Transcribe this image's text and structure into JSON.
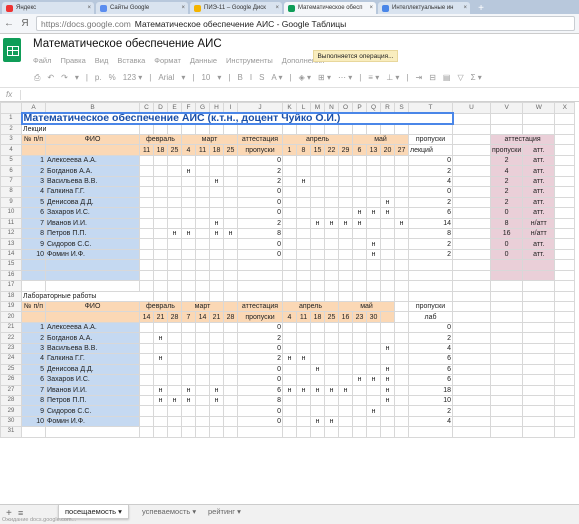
{
  "browser": {
    "tabs": [
      {
        "label": "Яндекс",
        "color": "#e33"
      },
      {
        "label": "Сайты Google",
        "color": "#5b8def"
      },
      {
        "label": "ПИЭ-11 – Google Диск",
        "color": "#f4b400"
      },
      {
        "label": "Математическое обесп",
        "color": "#0f9d58"
      },
      {
        "label": "Интеллектуальные ин",
        "color": "#4a86e8"
      }
    ],
    "active_tab_index": 3,
    "new_tab": "+",
    "back": "←",
    "forward": "Я",
    "url_prefix": "https://docs.google.com",
    "url_rest": "Математическое обеспечение АИС - Google Таблицы"
  },
  "doc": {
    "title": "Математическое обеспечение АИС",
    "menu": [
      "Файл",
      "Правка",
      "Вид",
      "Вставка",
      "Формат",
      "Данные",
      "Инструменты",
      "Дополнения"
    ],
    "operation": "Выполняется операция...",
    "toolbar": [
      "⎙",
      "↶",
      "↷",
      "▾",
      "|",
      "р.",
      "%",
      "123 ▾",
      "|",
      "Arial",
      "▾",
      "|",
      "10",
      "▾",
      "|",
      "B",
      "I",
      "S",
      "A ▾",
      "|",
      "◈ ▾",
      "⊞ ▾",
      "⋯ ▾",
      "|",
      "≡ ▾",
      "⊥ ▾",
      "|",
      "⇥",
      "⊟",
      "▤",
      "▽",
      "Σ ▾"
    ],
    "fx": "fx"
  },
  "columns": [
    "A",
    "B",
    "C",
    "D",
    "E",
    "F",
    "G",
    "H",
    "I",
    "J",
    "K",
    "L",
    "M",
    "N",
    "O",
    "P",
    "Q",
    "R",
    "S",
    "T",
    "U",
    "V",
    "W",
    "X"
  ],
  "rows": [
    {
      "n": "1",
      "c": [
        [
          "A1",
          "Математическое обеспечение АИС (к.т.н., доцент Чуйко О.И.)",
          "big",
          20
        ]
      ]
    },
    {
      "n": "2",
      "c": [
        [
          "A",
          "Лекции",
          "lbl",
          2
        ]
      ]
    },
    {
      "n": "3",
      "c": [
        [
          "A",
          "№ п/п",
          "or",
          1
        ],
        [
          "B",
          "ФИО",
          "or",
          1
        ],
        [
          "C",
          "февраль",
          "or",
          3
        ],
        [
          "F",
          "март",
          "or",
          4
        ],
        [
          "J",
          "аттестация",
          "or",
          1
        ],
        [
          "K",
          "апрель",
          "or",
          5
        ],
        [
          "P",
          "май",
          "or",
          4
        ],
        [
          "T",
          "пропуски",
          "c",
          1
        ],
        [
          "U",
          "",
          "",
          1
        ],
        [
          "V",
          "аттестация",
          "pk",
          2
        ]
      ]
    },
    {
      "n": "4",
      "c": [
        [
          "A",
          "",
          "or",
          1
        ],
        [
          "B",
          "",
          "or",
          1
        ],
        [
          "C",
          "11",
          "or",
          1
        ],
        [
          "D",
          "18",
          "or",
          1
        ],
        [
          "E",
          "25",
          "or",
          1
        ],
        [
          "F",
          "4",
          "or",
          1
        ],
        [
          "G",
          "11",
          "or",
          1
        ],
        [
          "H",
          "18",
          "or",
          1
        ],
        [
          "I",
          "25",
          "or",
          1
        ],
        [
          "J",
          "пропуски",
          "or",
          1
        ],
        [
          "K",
          "1",
          "or",
          1
        ],
        [
          "L",
          "8",
          "or",
          1
        ],
        [
          "M",
          "15",
          "or",
          1
        ],
        [
          "N",
          "22",
          "or",
          1
        ],
        [
          "O",
          "29",
          "or",
          1
        ],
        [
          "P",
          "6",
          "or",
          1
        ],
        [
          "Q",
          "13",
          "or",
          1
        ],
        [
          "R",
          "20",
          "or",
          1
        ],
        [
          "S",
          "27",
          "or",
          1
        ],
        [
          "T",
          "лекций",
          "",
          1
        ],
        [
          "U",
          "",
          "",
          1
        ],
        [
          "V",
          "пропуски",
          "pk",
          1
        ],
        [
          "W",
          "атт.",
          "pk",
          1
        ]
      ]
    }
  ],
  "lectures": [
    {
      "n": "5",
      "num": "1",
      "name": "Алексеева А.А.",
      "marks": {},
      "prop": "0",
      "total": "0",
      "vp": "2",
      "va": "атт."
    },
    {
      "n": "6",
      "num": "2",
      "name": "Богданов А.А.",
      "marks": {
        "F": "н"
      },
      "prop": "2",
      "total": "2",
      "vp": "4",
      "va": "атт."
    },
    {
      "n": "7",
      "num": "3",
      "name": "Васильева В.В.",
      "marks": {
        "H": "н",
        "L": "н"
      },
      "prop": "2",
      "total": "4",
      "vp": "2",
      "va": "атт."
    },
    {
      "n": "8",
      "num": "4",
      "name": "Галкина Г.Г.",
      "marks": {},
      "prop": "0",
      "total": "0",
      "vp": "2",
      "va": "атт."
    },
    {
      "n": "9",
      "num": "5",
      "name": "Денисова Д.Д.",
      "marks": {
        "R": "н"
      },
      "prop": "0",
      "total": "2",
      "vp": "2",
      "va": "атт."
    },
    {
      "n": "10",
      "num": "6",
      "name": "Захаров И.С.",
      "marks": {
        "P": "н",
        "Q": "н",
        "R": "н"
      },
      "prop": "0",
      "total": "6",
      "vp": "0",
      "va": "атт."
    },
    {
      "n": "11",
      "num": "7",
      "name": "Иванов И.И.",
      "marks": {
        "H": "н",
        "M": "н",
        "N": "н",
        "O": "н",
        "P": "н",
        "S": "н"
      },
      "prop": "2",
      "total": "14",
      "vp": "8",
      "va": "н/атт"
    },
    {
      "n": "12",
      "num": "8",
      "name": "Петров П.П.",
      "marks": {
        "E": "н",
        "F": "н",
        "H": "н",
        "I": "н"
      },
      "prop": "8",
      "total": "8",
      "vp": "16",
      "va": "н/атт"
    },
    {
      "n": "13",
      "num": "9",
      "name": "Сидоров С.С.",
      "marks": {
        "Q": "н"
      },
      "prop": "0",
      "total": "2",
      "vp": "0",
      "va": "атт."
    },
    {
      "n": "14",
      "num": "10",
      "name": "Фомин И.Ф.",
      "marks": {
        "Q": "н"
      },
      "prop": "0",
      "total": "2",
      "vp": "0",
      "va": "атт."
    }
  ],
  "blank_rows": [
    "15",
    "16",
    "17"
  ],
  "labs_label": {
    "n": "18",
    "text": "Лабораторные работы"
  },
  "labs_hdr": [
    {
      "n": "19",
      "c": [
        [
          "A",
          "№ п/п",
          "or",
          1
        ],
        [
          "B",
          "ФИО",
          "or",
          1
        ],
        [
          "C",
          "февраль",
          "or",
          3
        ],
        [
          "F",
          "март",
          "or",
          3
        ],
        [
          "I",
          "",
          "or",
          1
        ],
        [
          "J",
          "аттестация",
          "or",
          1
        ],
        [
          "K",
          "апрель",
          "or",
          4
        ],
        [
          "O",
          "май",
          "or",
          4
        ],
        [
          "S",
          "",
          "",
          1
        ],
        [
          "T",
          "пропуски",
          "c",
          1
        ]
      ]
    },
    {
      "n": "20",
      "c": [
        [
          "A",
          "",
          "or",
          1
        ],
        [
          "B",
          "",
          "or",
          1
        ],
        [
          "C",
          "14",
          "or",
          1
        ],
        [
          "D",
          "21",
          "or",
          1
        ],
        [
          "E",
          "28",
          "or",
          1
        ],
        [
          "F",
          "7",
          "or",
          1
        ],
        [
          "G",
          "14",
          "or",
          1
        ],
        [
          "H",
          "21",
          "or",
          1
        ],
        [
          "I",
          "28",
          "or",
          1
        ],
        [
          "J",
          "пропуски",
          "or",
          1
        ],
        [
          "K",
          "4",
          "or",
          1
        ],
        [
          "L",
          "11",
          "or",
          1
        ],
        [
          "M",
          "18",
          "or",
          1
        ],
        [
          "N",
          "25",
          "or",
          1
        ],
        [
          "O",
          "16",
          "or",
          1
        ],
        [
          "P",
          "23",
          "or",
          1
        ],
        [
          "Q",
          "30",
          "or",
          1
        ],
        [
          "R",
          "",
          "or",
          1
        ],
        [
          "S",
          "",
          "",
          1
        ],
        [
          "T",
          "лаб",
          "c",
          1
        ]
      ]
    }
  ],
  "labs": [
    {
      "n": "21",
      "num": "1",
      "name": "Алексеева А.А.",
      "marks": {},
      "prop": "0",
      "total": "0"
    },
    {
      "n": "22",
      "num": "2",
      "name": "Богданов А.А.",
      "marks": {
        "D": "н"
      },
      "prop": "2",
      "total": "2"
    },
    {
      "n": "23",
      "num": "3",
      "name": "Васильева В.В.",
      "marks": {
        "R": "н"
      },
      "prop": "0",
      "total": "4"
    },
    {
      "n": "24",
      "num": "4",
      "name": "Галкина Г.Г.",
      "marks": {
        "D": "н",
        "K": "н",
        "L": "н"
      },
      "prop": "2",
      "total": "6"
    },
    {
      "n": "25",
      "num": "5",
      "name": "Денисова Д.Д.",
      "marks": {
        "M": "н",
        "R": "н"
      },
      "prop": "0",
      "total": "6"
    },
    {
      "n": "26",
      "num": "6",
      "name": "Захаров И.С.",
      "marks": {
        "P": "н",
        "Q": "н",
        "R": "н"
      },
      "prop": "0",
      "total": "6"
    },
    {
      "n": "27",
      "num": "7",
      "name": "Иванов И.И.",
      "marks": {
        "D": "н",
        "F": "н",
        "H": "н",
        "K": "н",
        "L": "н",
        "M": "н",
        "N": "н",
        "O": "н",
        "R": "н"
      },
      "prop": "6",
      "total": "18"
    },
    {
      "n": "28",
      "num": "8",
      "name": "Петров П.П.",
      "marks": {
        "D": "н",
        "E": "н",
        "F": "н",
        "H": "н",
        "R": "н"
      },
      "prop": "8",
      "total": "10"
    },
    {
      "n": "29",
      "num": "9",
      "name": "Сидоров С.С.",
      "marks": {
        "Q": "н"
      },
      "prop": "0",
      "total": "2"
    },
    {
      "n": "30",
      "num": "10",
      "name": "Фомин И.Ф.",
      "marks": {
        "M": "н",
        "N": "н"
      },
      "prop": "0",
      "total": "4"
    }
  ],
  "last_rows": [
    "31"
  ],
  "sheets": {
    "add": "+",
    "list": "≡",
    "items": [
      {
        "label": "посещаемость ▾",
        "active": true
      },
      {
        "label": "успеваемость ▾",
        "active": false
      },
      {
        "label": "рейтинг ▾",
        "active": false
      }
    ]
  },
  "status": "Ожидание docs.google.com..."
}
